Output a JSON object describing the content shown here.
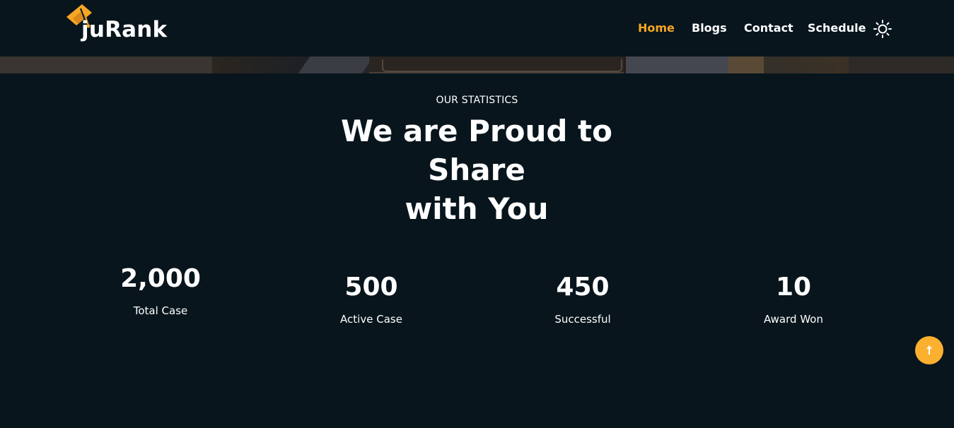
{
  "brand": {
    "name": "juRank",
    "logo_icon": "graduation-cap-icon",
    "accent_color": "#f5a623"
  },
  "nav": {
    "items": [
      {
        "label": "Home",
        "active": true
      },
      {
        "label": "Blogs",
        "active": false
      },
      {
        "label": "Contact",
        "active": false
      },
      {
        "label": "Schedule",
        "active": false
      }
    ],
    "theme_toggle_icon": "sun-icon"
  },
  "statistics": {
    "eyebrow": "OUR STATISTICS",
    "headline_line1": "We are Proud to Share",
    "headline_line2": "with You",
    "items": [
      {
        "value": "2,000",
        "label": "Total Case"
      },
      {
        "value": "500",
        "label": "Active Case"
      },
      {
        "value": "450",
        "label": "Successful"
      },
      {
        "value": "10",
        "label": "Award Won"
      }
    ]
  },
  "scroll_top": {
    "icon": "arrow-up-icon",
    "color": "#fbb12f"
  },
  "colors": {
    "background": "#08151d",
    "text": "#ffffff"
  }
}
